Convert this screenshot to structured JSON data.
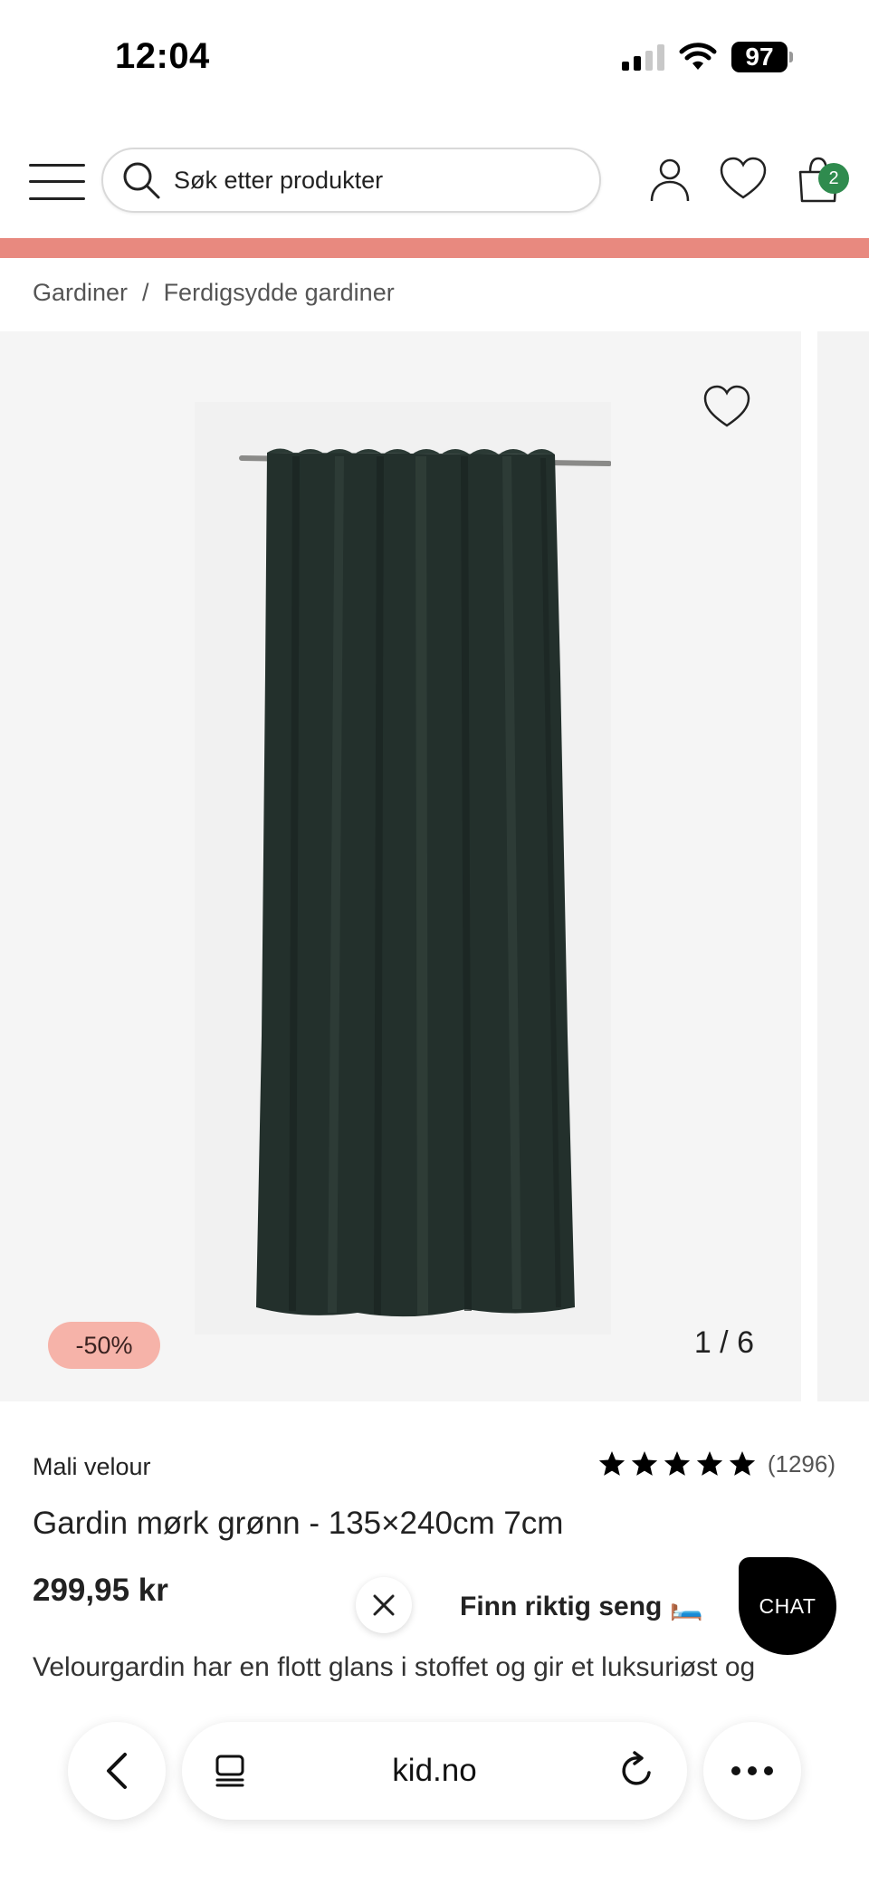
{
  "status_bar": {
    "time": "12:04",
    "battery": "97"
  },
  "header": {
    "search_placeholder": "Søk etter produkter",
    "cart_count": "2"
  },
  "colors": {
    "promo_bar": "#e8897f",
    "discount_badge": "#f6b3a9",
    "cart_badge": "#2f8b4e",
    "curtain": "#23302c"
  },
  "breadcrumb": [
    {
      "label": "Gardiner"
    },
    {
      "separator": "/"
    },
    {
      "label": "Ferdigsydde gardiner"
    }
  ],
  "gallery": {
    "discount": "-50%",
    "counter": "1 / 6"
  },
  "product": {
    "brand": "Mali velour",
    "rating_stars": 5,
    "rating_count": "(1296)",
    "title": "Gardin mørk grønn - 135×240cm 7cm",
    "price": "299,95 kr",
    "description": "Velourgardin har en flott glans i stoffet og gir et luksuriøst og"
  },
  "chat": {
    "teaser": "Finn riktig seng 🛏️",
    "button": "CHAT"
  },
  "browser": {
    "url": "kid.no"
  }
}
